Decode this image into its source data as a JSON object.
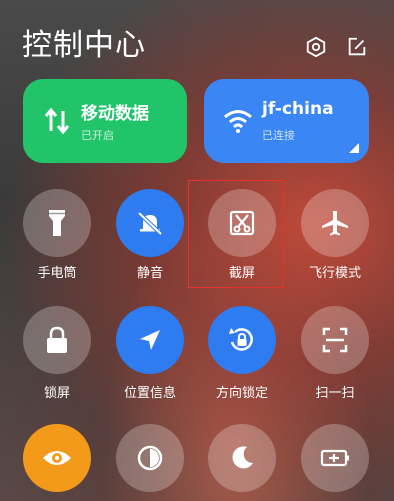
{
  "header": {
    "title": "控制中心"
  },
  "cards": [
    {
      "title": "移动数据",
      "status": "已开启",
      "color": "#22c46a"
    },
    {
      "title": "jf-china",
      "status": "已连接",
      "color": "#3a86f5"
    }
  ],
  "tiles": [
    {
      "label": "手电筒",
      "icon": "flashlight-icon",
      "state": "off"
    },
    {
      "label": "静音",
      "icon": "mute-bell-icon",
      "state": "on"
    },
    {
      "label": "截屏",
      "icon": "scissors-icon",
      "state": "off"
    },
    {
      "label": "飞行模式",
      "icon": "airplane-icon",
      "state": "off"
    },
    {
      "label": "锁屏",
      "icon": "lock-icon",
      "state": "off"
    },
    {
      "label": "位置信息",
      "icon": "location-arrow-icon",
      "state": "on"
    },
    {
      "label": "方向锁定",
      "icon": "rotation-lock-icon",
      "state": "on"
    },
    {
      "label": "扫一扫",
      "icon": "scan-icon",
      "state": "off"
    },
    {
      "label": "",
      "icon": "eye-icon",
      "state": "on"
    },
    {
      "label": "",
      "icon": "contrast-icon",
      "state": "off"
    },
    {
      "label": "",
      "icon": "moon-icon",
      "state": "off"
    },
    {
      "label": "",
      "icon": "battery-icon",
      "state": "off"
    }
  ],
  "colors": {
    "accent_blue": "#2f7bf0",
    "mobile_green": "#22c46a",
    "wifi_blue": "#3a86f5",
    "eye_orange": "#f39a1b",
    "highlight_red": "#e5322a"
  }
}
